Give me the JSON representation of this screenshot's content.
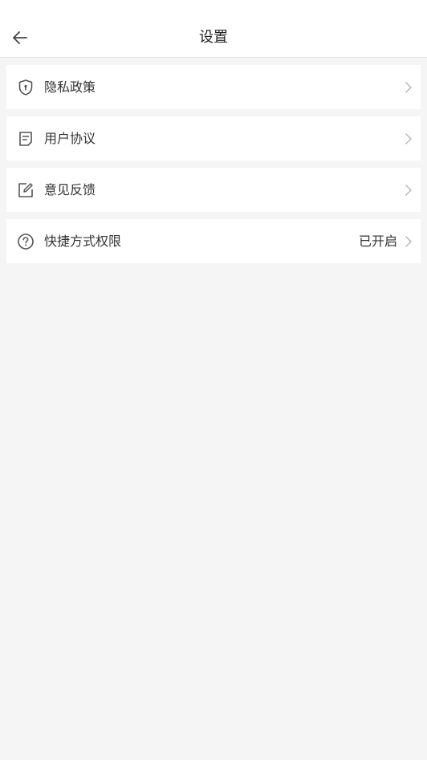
{
  "header": {
    "title": "设置",
    "back_icon": "arrow-left-icon"
  },
  "settings": {
    "items": [
      {
        "label": "隐私政策",
        "icon": "shield-icon",
        "value": ""
      },
      {
        "label": "用户协议",
        "icon": "document-icon",
        "value": ""
      },
      {
        "label": "意见反馈",
        "icon": "edit-icon",
        "value": ""
      },
      {
        "label": "快捷方式权限",
        "icon": "question-circle-icon",
        "value": "已开启"
      }
    ]
  },
  "colors": {
    "background": "#f5f5f5",
    "card": "#ffffff",
    "text": "#333333",
    "icon": "#555555",
    "chevron": "#b5b5b5"
  }
}
